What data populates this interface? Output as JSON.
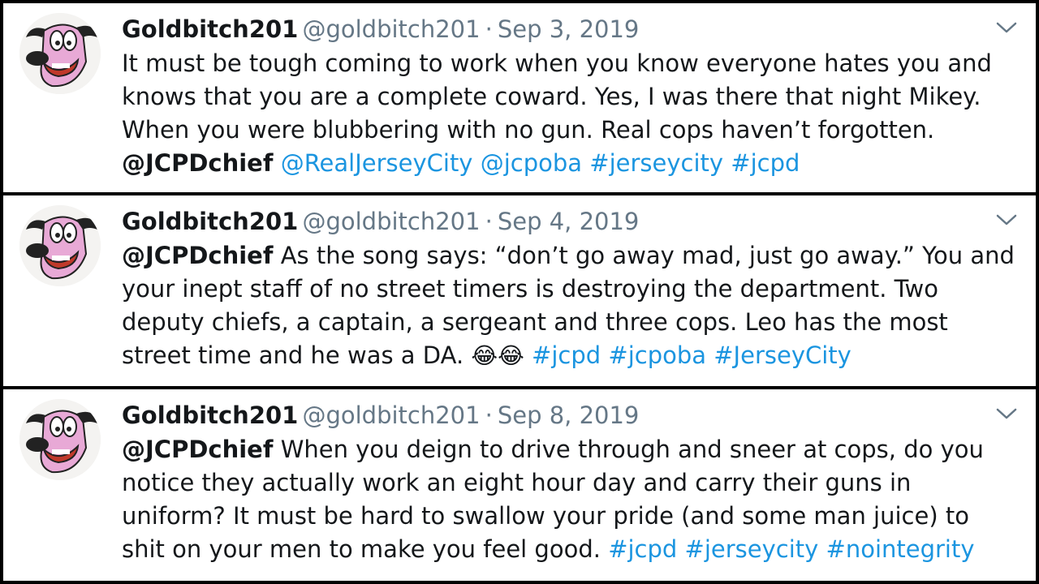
{
  "tweets": [
    {
      "name": "Goldbitch201",
      "handle": "@goldbitch201",
      "separator": "·",
      "date": "Sep 3, 2019",
      "text": "It must be tough coming to work when you know everyone hates you and knows that you are a complete coward. Yes, I was there that night Mikey. When you were blubbering with no gun. Real cops haven’t forgotten.",
      "mention": "@JCPDchief",
      "links": [
        "@RealJerseyCity",
        "@jcpoba",
        "#jerseycity",
        "#jcpd"
      ]
    },
    {
      "name": "Goldbitch201",
      "handle": "@goldbitch201",
      "separator": "·",
      "date": "Sep 4, 2019",
      "mention": "@JCPDchief",
      "text": "As the song says: “don’t go away mad, just go away.” You and your inept staff of no street timers is destroying the department. Two deputy chiefs, a captain, a sergeant and three cops. Leo has the most street time and he was a DA.",
      "emojis": "😂😂",
      "links": [
        "#jcpd",
        "#jcpoba",
        "#JerseyCity"
      ]
    },
    {
      "name": "Goldbitch201",
      "handle": "@goldbitch201",
      "separator": "·",
      "date": "Sep 8, 2019",
      "mention": "@JCPDchief",
      "text": "When you deign to drive through and sneer at cops, do you notice they actually work an eight hour day and carry their guns in uniform? It must be hard to swallow your pride (and some man juice) to shit on your men to make you feel good.",
      "links": [
        "#jcpd",
        "#jerseycity",
        "#nointegrity"
      ]
    }
  ],
  "colors": {
    "link": "#1b95e0",
    "meta": "#657786",
    "text": "#14171a",
    "avatar_dog": "#e8a9d6"
  },
  "icons": {
    "avatar": "courage-dog-avatar-icon",
    "menu": "chevron-down-icon"
  }
}
